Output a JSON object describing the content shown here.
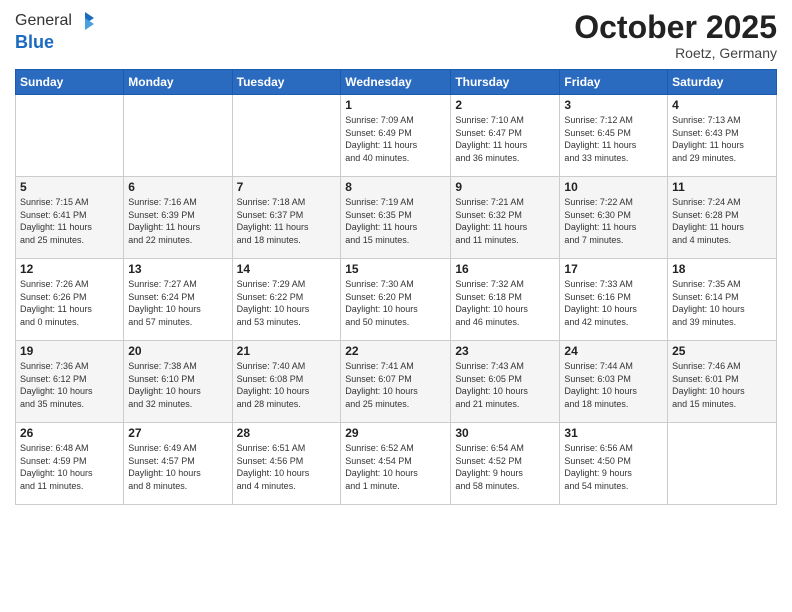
{
  "logo": {
    "general": "General",
    "blue": "Blue"
  },
  "title": "October 2025",
  "location": "Roetz, Germany",
  "days_of_week": [
    "Sunday",
    "Monday",
    "Tuesday",
    "Wednesday",
    "Thursday",
    "Friday",
    "Saturday"
  ],
  "weeks": [
    [
      {
        "day": "",
        "info": ""
      },
      {
        "day": "",
        "info": ""
      },
      {
        "day": "",
        "info": ""
      },
      {
        "day": "1",
        "info": "Sunrise: 7:09 AM\nSunset: 6:49 PM\nDaylight: 11 hours\nand 40 minutes."
      },
      {
        "day": "2",
        "info": "Sunrise: 7:10 AM\nSunset: 6:47 PM\nDaylight: 11 hours\nand 36 minutes."
      },
      {
        "day": "3",
        "info": "Sunrise: 7:12 AM\nSunset: 6:45 PM\nDaylight: 11 hours\nand 33 minutes."
      },
      {
        "day": "4",
        "info": "Sunrise: 7:13 AM\nSunset: 6:43 PM\nDaylight: 11 hours\nand 29 minutes."
      }
    ],
    [
      {
        "day": "5",
        "info": "Sunrise: 7:15 AM\nSunset: 6:41 PM\nDaylight: 11 hours\nand 25 minutes."
      },
      {
        "day": "6",
        "info": "Sunrise: 7:16 AM\nSunset: 6:39 PM\nDaylight: 11 hours\nand 22 minutes."
      },
      {
        "day": "7",
        "info": "Sunrise: 7:18 AM\nSunset: 6:37 PM\nDaylight: 11 hours\nand 18 minutes."
      },
      {
        "day": "8",
        "info": "Sunrise: 7:19 AM\nSunset: 6:35 PM\nDaylight: 11 hours\nand 15 minutes."
      },
      {
        "day": "9",
        "info": "Sunrise: 7:21 AM\nSunset: 6:32 PM\nDaylight: 11 hours\nand 11 minutes."
      },
      {
        "day": "10",
        "info": "Sunrise: 7:22 AM\nSunset: 6:30 PM\nDaylight: 11 hours\nand 7 minutes."
      },
      {
        "day": "11",
        "info": "Sunrise: 7:24 AM\nSunset: 6:28 PM\nDaylight: 11 hours\nand 4 minutes."
      }
    ],
    [
      {
        "day": "12",
        "info": "Sunrise: 7:26 AM\nSunset: 6:26 PM\nDaylight: 11 hours\nand 0 minutes."
      },
      {
        "day": "13",
        "info": "Sunrise: 7:27 AM\nSunset: 6:24 PM\nDaylight: 10 hours\nand 57 minutes."
      },
      {
        "day": "14",
        "info": "Sunrise: 7:29 AM\nSunset: 6:22 PM\nDaylight: 10 hours\nand 53 minutes."
      },
      {
        "day": "15",
        "info": "Sunrise: 7:30 AM\nSunset: 6:20 PM\nDaylight: 10 hours\nand 50 minutes."
      },
      {
        "day": "16",
        "info": "Sunrise: 7:32 AM\nSunset: 6:18 PM\nDaylight: 10 hours\nand 46 minutes."
      },
      {
        "day": "17",
        "info": "Sunrise: 7:33 AM\nSunset: 6:16 PM\nDaylight: 10 hours\nand 42 minutes."
      },
      {
        "day": "18",
        "info": "Sunrise: 7:35 AM\nSunset: 6:14 PM\nDaylight: 10 hours\nand 39 minutes."
      }
    ],
    [
      {
        "day": "19",
        "info": "Sunrise: 7:36 AM\nSunset: 6:12 PM\nDaylight: 10 hours\nand 35 minutes."
      },
      {
        "day": "20",
        "info": "Sunrise: 7:38 AM\nSunset: 6:10 PM\nDaylight: 10 hours\nand 32 minutes."
      },
      {
        "day": "21",
        "info": "Sunrise: 7:40 AM\nSunset: 6:08 PM\nDaylight: 10 hours\nand 28 minutes."
      },
      {
        "day": "22",
        "info": "Sunrise: 7:41 AM\nSunset: 6:07 PM\nDaylight: 10 hours\nand 25 minutes."
      },
      {
        "day": "23",
        "info": "Sunrise: 7:43 AM\nSunset: 6:05 PM\nDaylight: 10 hours\nand 21 minutes."
      },
      {
        "day": "24",
        "info": "Sunrise: 7:44 AM\nSunset: 6:03 PM\nDaylight: 10 hours\nand 18 minutes."
      },
      {
        "day": "25",
        "info": "Sunrise: 7:46 AM\nSunset: 6:01 PM\nDaylight: 10 hours\nand 15 minutes."
      }
    ],
    [
      {
        "day": "26",
        "info": "Sunrise: 6:48 AM\nSunset: 4:59 PM\nDaylight: 10 hours\nand 11 minutes."
      },
      {
        "day": "27",
        "info": "Sunrise: 6:49 AM\nSunset: 4:57 PM\nDaylight: 10 hours\nand 8 minutes."
      },
      {
        "day": "28",
        "info": "Sunrise: 6:51 AM\nSunset: 4:56 PM\nDaylight: 10 hours\nand 4 minutes."
      },
      {
        "day": "29",
        "info": "Sunrise: 6:52 AM\nSunset: 4:54 PM\nDaylight: 10 hours\nand 1 minute."
      },
      {
        "day": "30",
        "info": "Sunrise: 6:54 AM\nSunset: 4:52 PM\nDaylight: 9 hours\nand 58 minutes."
      },
      {
        "day": "31",
        "info": "Sunrise: 6:56 AM\nSunset: 4:50 PM\nDaylight: 9 hours\nand 54 minutes."
      },
      {
        "day": "",
        "info": ""
      }
    ]
  ]
}
